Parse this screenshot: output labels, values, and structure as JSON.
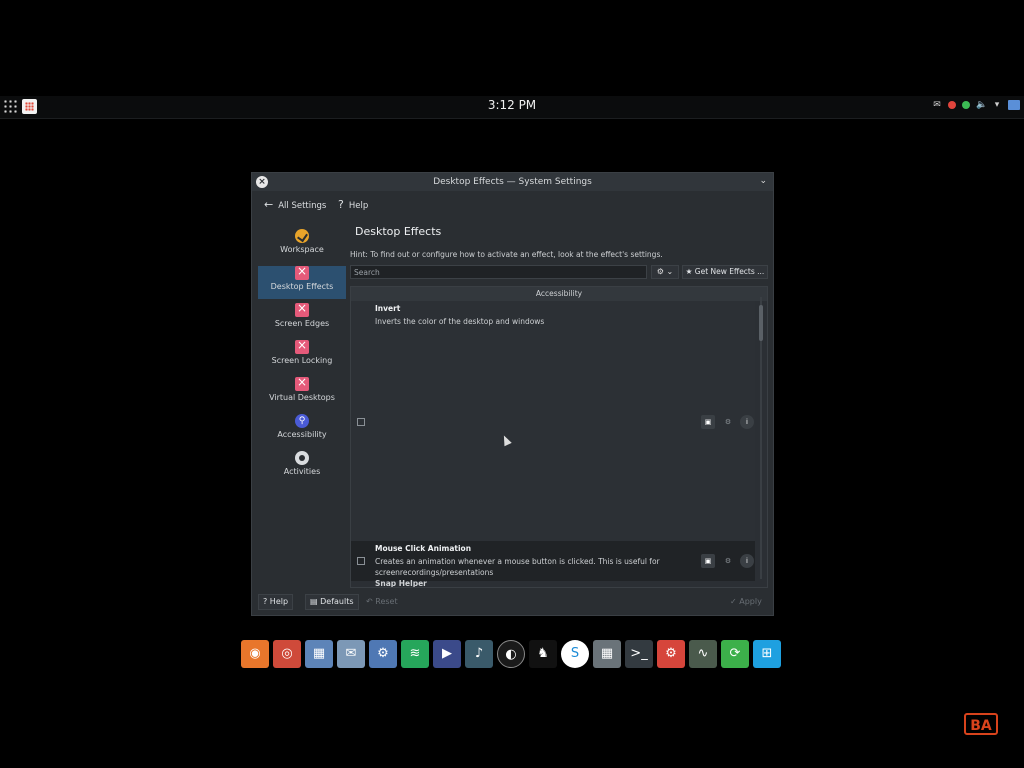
{
  "panel": {
    "clock": "3:12 PM"
  },
  "window": {
    "title": "Desktop Effects  — System Settings",
    "nav": {
      "back_label": "All Settings",
      "help_label": "Help"
    },
    "sidebar": {
      "items": [
        {
          "label": "Workspace",
          "icon": "workspace-icon"
        },
        {
          "label": "Desktop Effects",
          "icon": "desktop-effects-icon",
          "active": true
        },
        {
          "label": "Screen Edges",
          "icon": "screen-edges-icon"
        },
        {
          "label": "Screen Locking",
          "icon": "screen-locking-icon"
        },
        {
          "label": "Virtual Desktops",
          "icon": "virtual-desktops-icon"
        },
        {
          "label": "Accessibility",
          "icon": "accessibility-icon"
        },
        {
          "label": "Activities",
          "icon": "activities-icon"
        }
      ]
    },
    "main": {
      "title": "Desktop Effects",
      "hint": "Hint: To find out or configure how to activate an effect, look at the effect's settings.",
      "search_placeholder": "Search",
      "get_new_label": "Get New Effects ...",
      "category": "Accessibility",
      "effects": [
        {
          "name": "Invert",
          "description": "Inverts the color of the desktop and windows",
          "enabled": false
        },
        {
          "name": "Mouse Click Animation",
          "description": "Creates an animation whenever a mouse button is clicked. This is useful for screenrecordings/presentations",
          "enabled": false
        },
        {
          "name": "Snap Helper"
        }
      ]
    },
    "footer": {
      "help": "Help",
      "defaults": "Defaults",
      "reset": "Reset",
      "apply": "Apply"
    }
  },
  "dock": {
    "apps": [
      "firefox-icon",
      "chrome-icon",
      "files-icon",
      "mail-icon",
      "settings-icon",
      "spotify-icon",
      "video-editor-icon",
      "audio-icon",
      "obs-icon",
      "linux-icon",
      "skype-icon",
      "calculator-icon",
      "terminal-icon",
      "system-settings-icon",
      "monitor-icon",
      "refresh-icon",
      "windows-icon"
    ]
  },
  "watermark": "BA"
}
